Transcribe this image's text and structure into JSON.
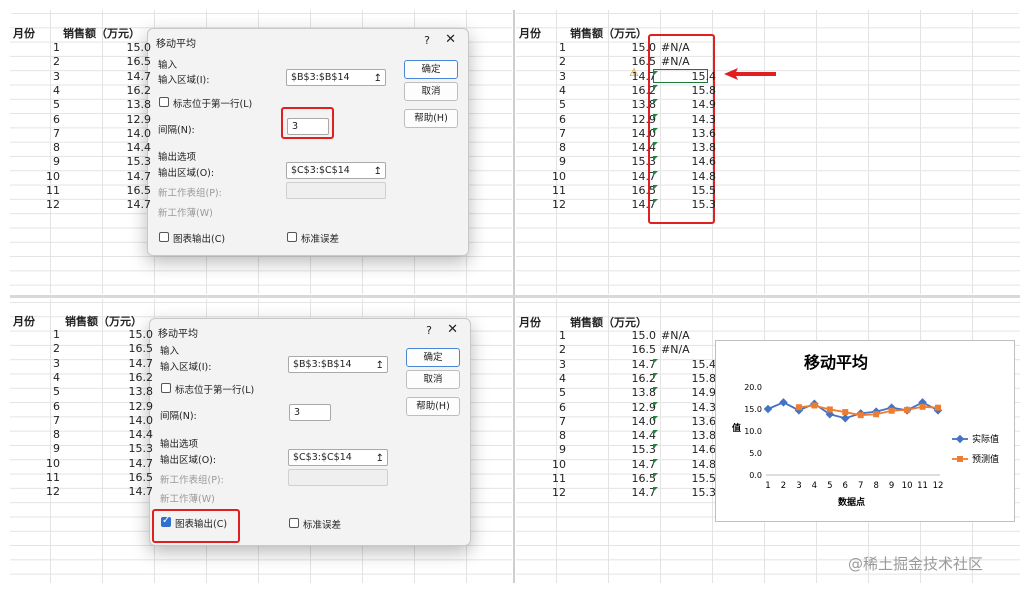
{
  "headers": {
    "month": "月份",
    "sales": "销售额（万元）"
  },
  "months": [
    "1",
    "2",
    "3",
    "4",
    "5",
    "6",
    "7",
    "8",
    "9",
    "10",
    "11",
    "12"
  ],
  "sales": [
    "15.0",
    "16.5",
    "14.7",
    "16.2",
    "13.8",
    "12.9",
    "14.0",
    "14.4",
    "15.3",
    "14.7",
    "16.5",
    "14.7"
  ],
  "moving_avg": [
    "#N/A",
    "#N/A",
    "15.4",
    "15.8",
    "14.9",
    "14.3",
    "13.6",
    "13.8",
    "14.6",
    "14.8",
    "15.5",
    "15.3"
  ],
  "dialog": {
    "title": "移动平均",
    "help": "?",
    "close": "✕",
    "input_section": "输入",
    "input_range_label": "输入区域(I):",
    "input_range_value": "$B$3:$B$14",
    "labels_first_row": "标志位于第一行(L)",
    "interval_label": "间隔(N):",
    "interval_value": "3",
    "output_section": "输出选项",
    "output_range_label": "输出区域(O):",
    "output_range_value": "$C$3:$C$14",
    "new_worksheet": "新工作表组(P):",
    "new_workbook": "新工作薄(W)",
    "chart_output": "图表输出(C)",
    "std_errors": "标准误差",
    "ok": "确定",
    "cancel": "取消",
    "help_btn": "帮助(H)",
    "ref_icon": "↥"
  },
  "chart_data": {
    "type": "line",
    "title": "移动平均",
    "xlabel": "数据点",
    "ylabel": "值",
    "x": [
      1,
      2,
      3,
      4,
      5,
      6,
      7,
      8,
      9,
      10,
      11,
      12
    ],
    "ylim": [
      0,
      20
    ],
    "yticks": [
      "0.0",
      "5.0",
      "10.0",
      "15.0",
      "20.0"
    ],
    "series": [
      {
        "name": "实际值",
        "color": "#4472C4",
        "values": [
          15.0,
          16.5,
          14.7,
          16.2,
          13.8,
          12.9,
          14.0,
          14.4,
          15.3,
          14.7,
          16.5,
          14.7
        ]
      },
      {
        "name": "预测值",
        "color": "#ED7D31",
        "values": [
          null,
          null,
          15.4,
          15.8,
          14.9,
          14.3,
          13.6,
          13.8,
          14.6,
          14.8,
          15.5,
          15.3
        ]
      }
    ]
  },
  "watermark": "@稀土掘金技术社区",
  "colors": {
    "highlight": "#e02020",
    "grid": "#e3e3e3"
  }
}
